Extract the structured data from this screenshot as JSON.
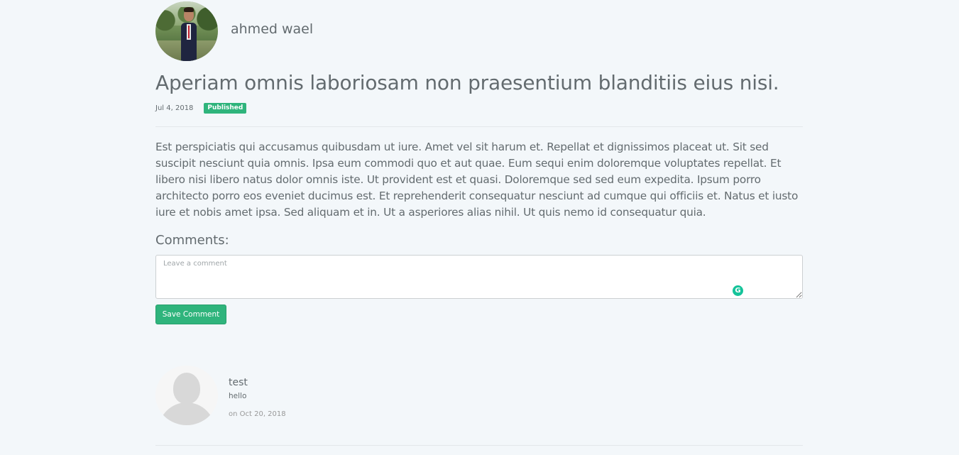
{
  "author": {
    "name": "ahmed wael",
    "avatar": "author-photo"
  },
  "post": {
    "title": "Aperiam omnis laboriosam non praesentium blanditiis eius nisi.",
    "date": "Jul 4, 2018",
    "status": "Published",
    "body": "Est perspiciatis qui accusamus quibusdam ut iure. Amet vel sit harum et. Repellat et dignissimos placeat ut. Sit sed suscipit nesciunt quia omnis. Ipsa eum commodi quo et aut quae. Eum sequi enim doloremque voluptates repellat. Et libero nisi libero natus dolor omnis iste. Ut provident est et quasi. Doloremque sed sed eum expedita. Ipsum porro architecto porro eos eveniet ducimus est. Et reprehenderit consequatur nesciunt ad cumque qui officiis et. Natus et iusto iure et nobis amet ipsa. Sed aliquam et in. Ut a asperiores alias nihil. Ut quis nemo id consequatur quia."
  },
  "comments_section": {
    "heading": "Comments:",
    "input_value": "",
    "input_placeholder": "Leave a comment",
    "save_label": "Save Comment",
    "items": [
      {
        "author": "test",
        "text": "hello",
        "date": "on Oct 20, 2018",
        "avatar": "default-user-silhouette"
      }
    ]
  },
  "colors": {
    "background": "#f3f7fa",
    "text": "#636b6f",
    "accent_green": "#2fb47c",
    "grammarly_green": "#15c39a"
  },
  "icons": {
    "grammarly": "grammarly-icon"
  }
}
